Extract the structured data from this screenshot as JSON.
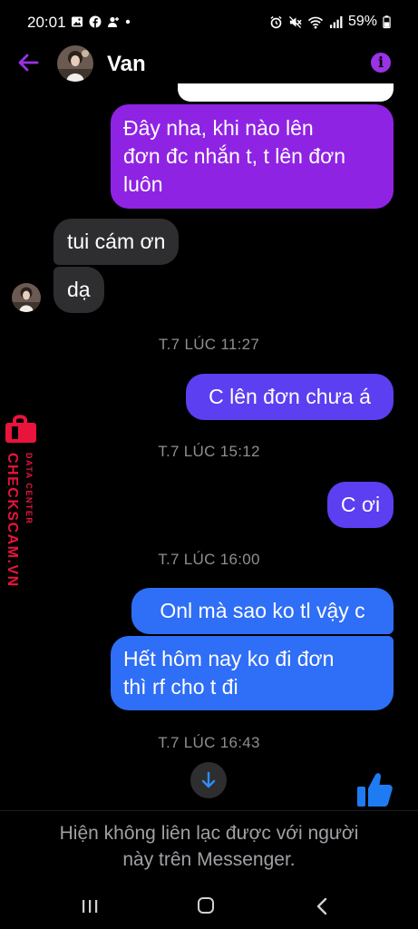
{
  "status_bar": {
    "time": "20:01",
    "battery": "59%",
    "left_icons": [
      "gallery-icon",
      "facebook-icon",
      "person-icon",
      "dot-icon"
    ],
    "right_icons": [
      "alarm-icon",
      "mute-icon",
      "wifi-icon",
      "signal-icon",
      "battery-icon"
    ]
  },
  "header": {
    "contact_name": "Van",
    "accent_color": "#9b32e6"
  },
  "messages": [
    {
      "type": "outgoing",
      "text_lines": [
        "Đây nha, khi nào lên",
        "đơn đc nhắn t, t lên đơn",
        "luôn"
      ]
    },
    {
      "type": "incoming",
      "text": "tui cám ơn"
    },
    {
      "type": "incoming",
      "text": "dạ"
    },
    {
      "type": "timestamp",
      "text": "T.7 LÚC 11:27"
    },
    {
      "type": "outgoing",
      "text": "C lên đơn chưa á"
    },
    {
      "type": "timestamp",
      "text": "T.7 LÚC 15:12"
    },
    {
      "type": "outgoing",
      "text": "C ơi"
    },
    {
      "type": "timestamp",
      "text": "T.7 LÚC 16:00"
    },
    {
      "type": "outgoing",
      "text": "Onl mà sao ko tl vậy c"
    },
    {
      "type": "outgoing",
      "text_lines": [
        "Hết hôm nay ko đi đơn",
        "thì rf cho t đi"
      ]
    },
    {
      "type": "timestamp",
      "text": "T.7 LÚC 16:43"
    }
  ],
  "watermark": {
    "brand": "CHECKSCAM.VN",
    "subtitle": "DATA CENTER"
  },
  "footer": {
    "unavailable_lines": [
      "Hiện không liên lạc được với người",
      "này trên Messenger."
    ]
  },
  "colors": {
    "bubble_purple": "#8f23e3",
    "bubble_indigo": "#5b3ff0",
    "bubble_blue": "#2f6ef6",
    "bubble_incoming": "#2e2e30",
    "like_blue": "#1f7bf2"
  }
}
